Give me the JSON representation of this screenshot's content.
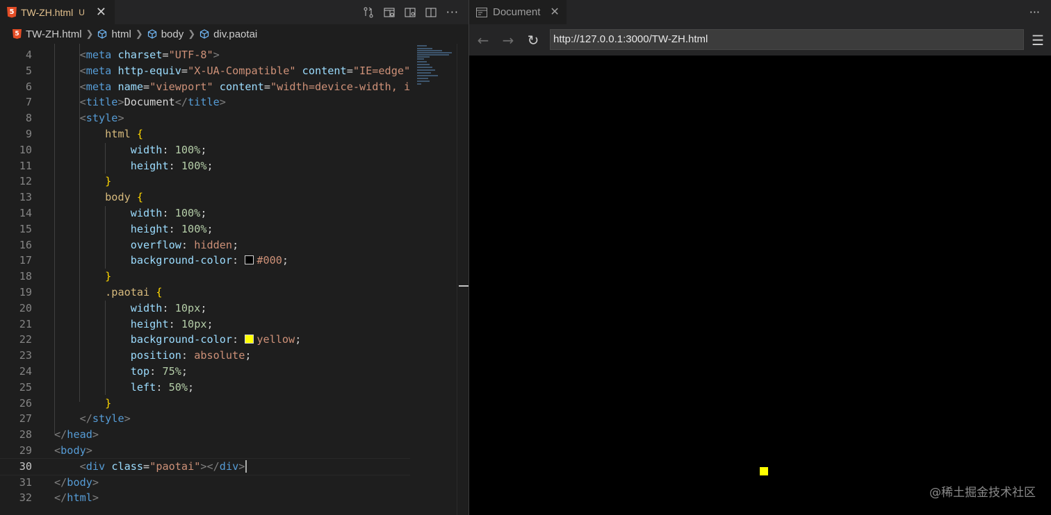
{
  "editor": {
    "tab": {
      "filename": "TW-ZH.html",
      "status": "U",
      "file_icon": "html5-icon"
    },
    "breadcrumb": [
      "TW-ZH.html",
      "html",
      "body",
      "div.paotai"
    ],
    "line_numbers": [
      "4",
      "5",
      "6",
      "7",
      "8",
      "9",
      "10",
      "11",
      "12",
      "13",
      "14",
      "15",
      "16",
      "17",
      "18",
      "19",
      "20",
      "21",
      "22",
      "23",
      "24",
      "25",
      "26",
      "27",
      "28",
      "29",
      "30",
      "31",
      "32"
    ],
    "active_line": "30",
    "code": {
      "l4_attr1": "charset",
      "l4_val1": "\"UTF-8\"",
      "l5_attr1": "http-equiv",
      "l5_val1": "\"X-UA-Compatible\"",
      "l5_attr2": "content",
      "l5_val2": "\"IE=edge\"",
      "l6_attr1": "name",
      "l6_val1": "\"viewport\"",
      "l6_attr2": "content",
      "l6_val2": "\"width=device-width, i",
      "l7_text": "Document",
      "l9_sel": "html",
      "l13_sel": "body",
      "l19_sel": ".paotai",
      "width": "width",
      "height": "height",
      "overflow": "overflow",
      "bg": "background-color",
      "position": "position",
      "top": "top",
      "left": "left",
      "v100": "100%",
      "hidden": "hidden",
      "black": "#000",
      "v10": "10px",
      "yellow": "yellow",
      "absolute": "absolute",
      "v75": "75%",
      "v50": "50%",
      "l30_attr": "class",
      "l30_val": "\"paotai\""
    }
  },
  "preview": {
    "tab_title": "Document",
    "url": "http://127.0.0.1:3000/TW-ZH.html",
    "watermark": "@稀土掘金技术社区"
  },
  "colors": {
    "swatch_black": "#000000",
    "swatch_yellow": "#ffff00",
    "box": "#ffff00"
  }
}
